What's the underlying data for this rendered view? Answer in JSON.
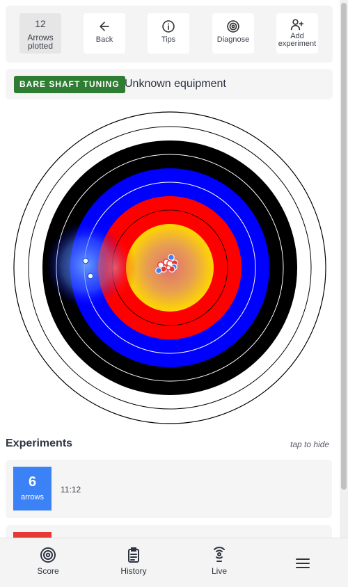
{
  "toolbar": {
    "arrow_count": "12",
    "arrow_count_label": "Arrows plotted",
    "buttons": [
      {
        "label": "Back",
        "icon": "arrow-left-icon"
      },
      {
        "label": "Tips",
        "icon": "info-icon"
      },
      {
        "label": "Diagnose",
        "icon": "target-icon"
      },
      {
        "label": "Add experiment",
        "icon": "add-user-icon"
      }
    ]
  },
  "session": {
    "badge": "BARE SHAFT TUNING",
    "equipment": "Unknown equipment",
    "badge_color": "#2e7d32"
  },
  "target_face": {
    "ring_colors": [
      "#ffffff",
      "#000000",
      "#0000ff",
      "#ff0000",
      "#ffd700"
    ],
    "arrows_blue": 8,
    "arrows_red": 4
  },
  "experiments": {
    "title": "Experiments",
    "hint": "tap to hide",
    "items": [
      {
        "count": "6",
        "unit": "arrows",
        "time": "11:12",
        "color": "#3b82f6"
      },
      {
        "count": "",
        "unit": "",
        "time": "",
        "color": "#e53935"
      }
    ]
  },
  "nav": {
    "items": [
      {
        "label": "Score",
        "icon": "target-icon"
      },
      {
        "label": "History",
        "icon": "clipboard-icon"
      },
      {
        "label": "Live",
        "icon": "broadcast-icon"
      },
      {
        "label": "",
        "icon": "menu-icon"
      }
    ]
  }
}
